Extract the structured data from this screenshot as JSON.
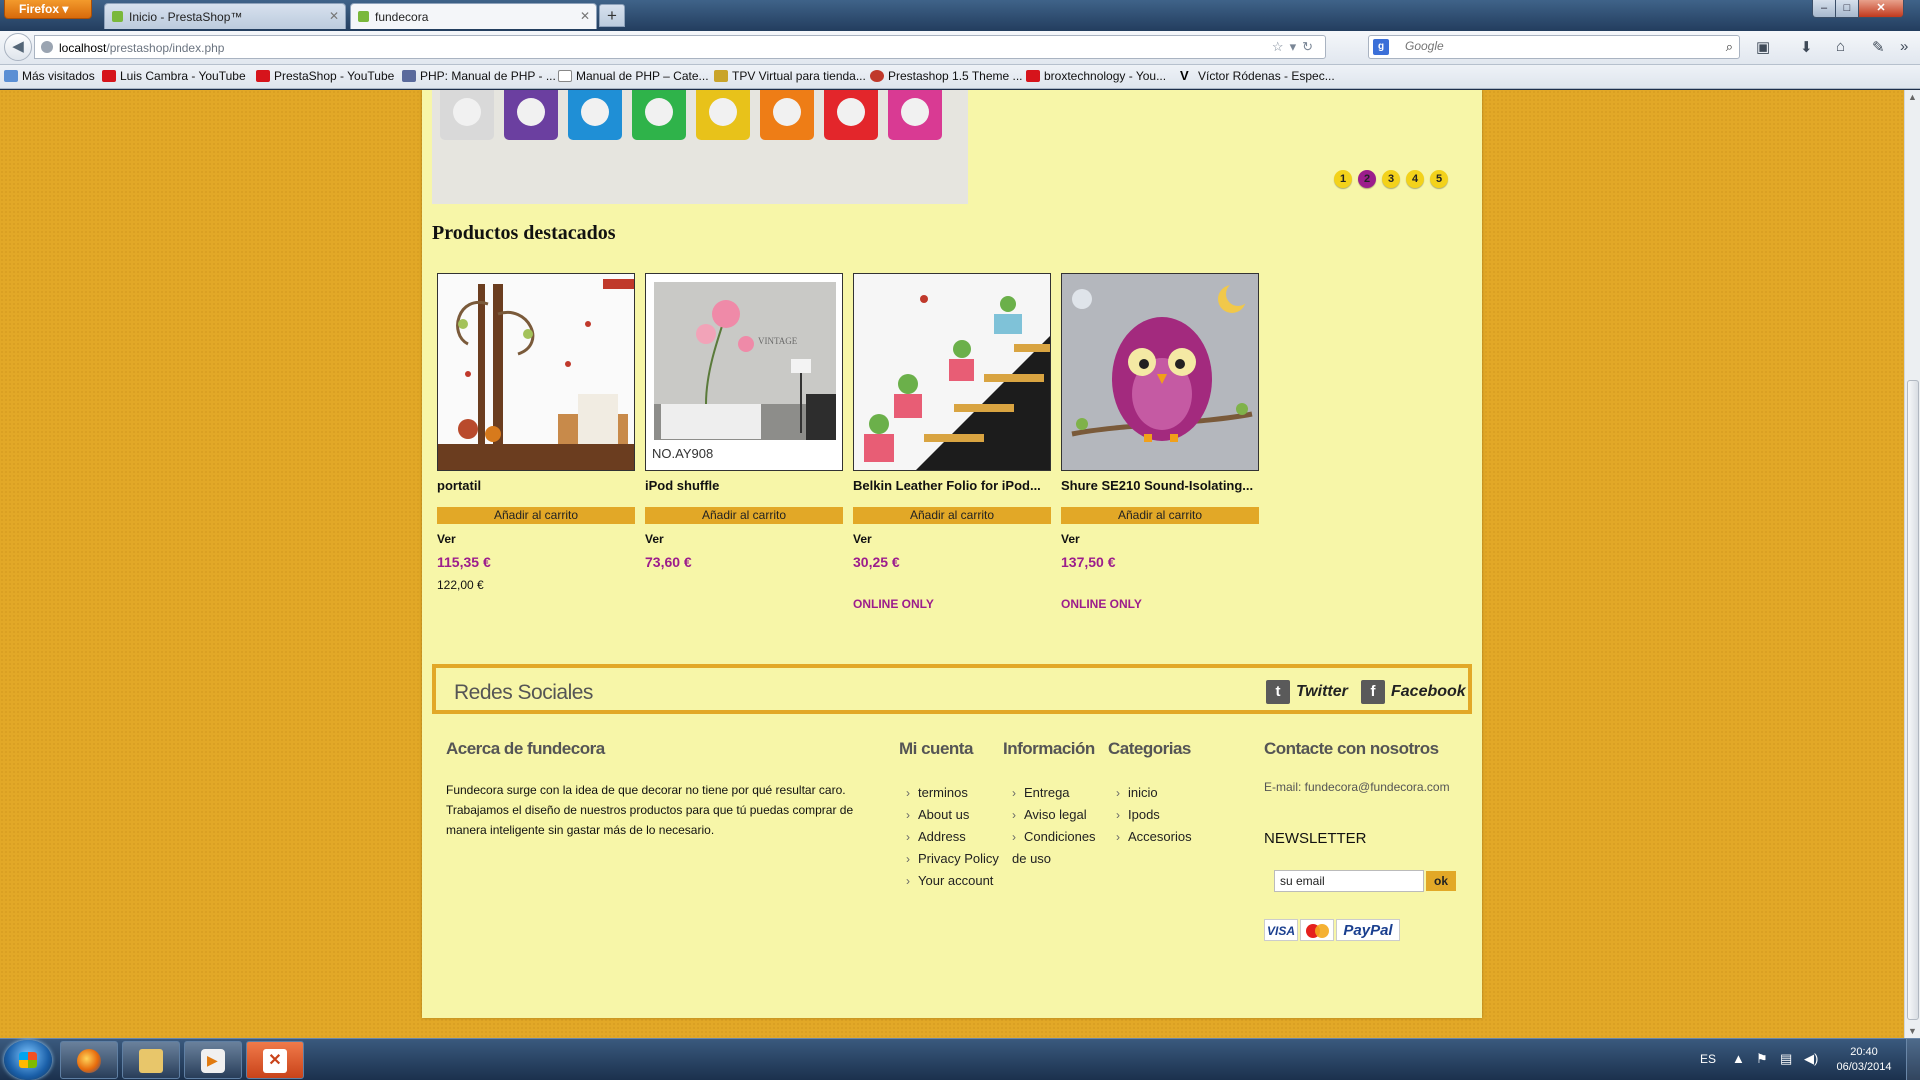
{
  "browser": {
    "menu_label": "Firefox",
    "tabs": [
      {
        "title": "Inicio - PrestaShop™"
      },
      {
        "title": "fundecora"
      }
    ],
    "new_tab": "+",
    "window": {
      "min": "–",
      "max": "□",
      "close": "✕"
    },
    "url": {
      "host": "localhost",
      "path": "/prestashop/index.php"
    },
    "search_placeholder": "Google",
    "bookmarks": [
      {
        "label": "Más visitados",
        "icon": "star-icon"
      },
      {
        "label": "Luis Cambra - YouTube",
        "icon": "youtube-icon"
      },
      {
        "label": "PrestaShop - YouTube",
        "icon": "youtube-icon"
      },
      {
        "label": "PHP: Manual de PHP - ...",
        "icon": "php-icon"
      },
      {
        "label": "Manual de PHP – Cate...",
        "icon": "page-icon"
      },
      {
        "label": "TPV Virtual para tienda...",
        "icon": "cart-icon"
      },
      {
        "label": "Prestashop 1.5 Theme ...",
        "icon": "prestashop-icon"
      },
      {
        "label": "broxtechnology - You...",
        "icon": "youtube-icon"
      },
      {
        "label": "Víctor Ródenas - Espec...",
        "icon": "v-icon"
      }
    ]
  },
  "slider": {
    "pages": [
      "1",
      "2",
      "3",
      "4",
      "5"
    ],
    "active_page": 2,
    "ipod_colors": [
      "#d9d9d9",
      "#6b3fa0",
      "#1f8fd6",
      "#2fb34a",
      "#e8c21a",
      "#ee7d16",
      "#e3262b",
      "#d93a93"
    ]
  },
  "featured": {
    "title": "Productos destacados",
    "products": [
      {
        "name": "portatil",
        "cart_label": "Añadir al carrito",
        "view_label": "Ver",
        "price": "115,35 €",
        "old_price": "122,00 €",
        "online_only": ""
      },
      {
        "name": "iPod shuffle",
        "cart_label": "Añadir al carrito",
        "view_label": "Ver",
        "price": "73,60 €",
        "old_price": "",
        "online_only": "",
        "image_caption": "NO.AY908",
        "image_text": "VINTAGE"
      },
      {
        "name": "Belkin Leather Folio for iPod...",
        "cart_label": "Añadir al carrito",
        "view_label": "Ver",
        "price": "30,25 €",
        "old_price": "",
        "online_only": "ONLINE ONLY"
      },
      {
        "name": "Shure SE210 Sound-Isolating...",
        "cart_label": "Añadir al carrito",
        "view_label": "Ver",
        "price": "137,50 €",
        "old_price": "",
        "online_only": "ONLINE ONLY"
      }
    ]
  },
  "social": {
    "title": "Redes Sociales",
    "twitter": "Twitter",
    "facebook": "Facebook"
  },
  "footer": {
    "about": {
      "title": "Acerca de fundecora",
      "text": "Fundecora surge con la idea de que decorar no tiene por qué resultar caro. Trabajamos el diseño de nuestros productos para que tú puedas comprar de manera inteligente sin gastar más de lo necesario."
    },
    "account": {
      "title": "Mi cuenta",
      "items": [
        "terminos",
        "About us",
        "Address",
        "Privacy Policy",
        "Your account"
      ]
    },
    "info": {
      "title": "Información",
      "items": [
        "Entrega",
        "Aviso legal",
        "Condiciones",
        "de uso"
      ]
    },
    "categories": {
      "title": "Categorias",
      "items": [
        "inicio",
        "Ipods",
        "Accesorios"
      ]
    },
    "contact": {
      "title": "Contacte con nosotros",
      "email": "E-mail: fundecora@fundecora.com"
    },
    "newsletter": {
      "title": "NEWSLETTER",
      "value": "su email",
      "ok": "ok"
    },
    "payments": {
      "visa": "VISA",
      "paypal": "PayPal"
    }
  },
  "taskbar": {
    "lang": "ES",
    "time": "20:40",
    "date": "06/03/2014"
  },
  "colors": {
    "page_bg": "#e2a827",
    "content_bg": "#f7f6a8",
    "accent_purple": "#9c1d8c",
    "button_gold": "#e2a827"
  }
}
